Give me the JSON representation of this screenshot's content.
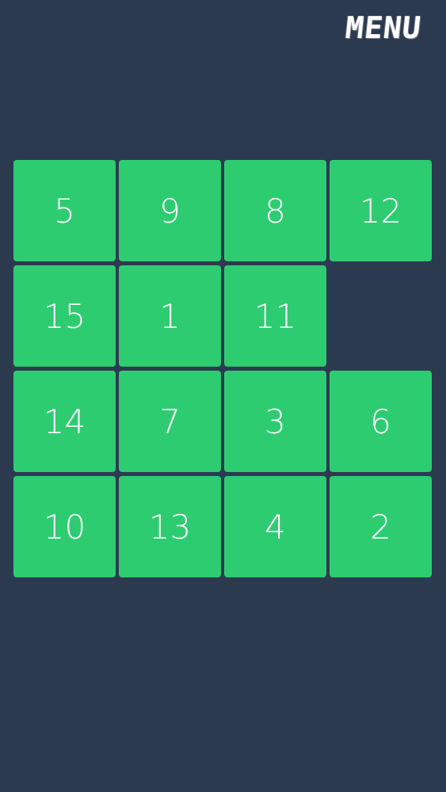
{
  "menu": {
    "label": "MENU"
  },
  "board": {
    "rows": 4,
    "cols": 4,
    "tile_color": "#2ecc71",
    "background_color": "#2c3a4f",
    "empty_cell": {
      "row": 1,
      "col": 3
    },
    "tiles": [
      {
        "value": "5",
        "row": 0,
        "col": 0
      },
      {
        "value": "9",
        "row": 0,
        "col": 1
      },
      {
        "value": "8",
        "row": 0,
        "col": 2
      },
      {
        "value": "12",
        "row": 0,
        "col": 3
      },
      {
        "value": "15",
        "row": 1,
        "col": 0
      },
      {
        "value": "1",
        "row": 1,
        "col": 1
      },
      {
        "value": "11",
        "row": 1,
        "col": 2
      },
      {
        "value": "14",
        "row": 2,
        "col": 0
      },
      {
        "value": "7",
        "row": 2,
        "col": 1
      },
      {
        "value": "3",
        "row": 2,
        "col": 2
      },
      {
        "value": "6",
        "row": 2,
        "col": 3
      },
      {
        "value": "10",
        "row": 3,
        "col": 0
      },
      {
        "value": "13",
        "row": 3,
        "col": 1
      },
      {
        "value": "4",
        "row": 3,
        "col": 2
      },
      {
        "value": "2",
        "row": 3,
        "col": 3
      }
    ]
  }
}
